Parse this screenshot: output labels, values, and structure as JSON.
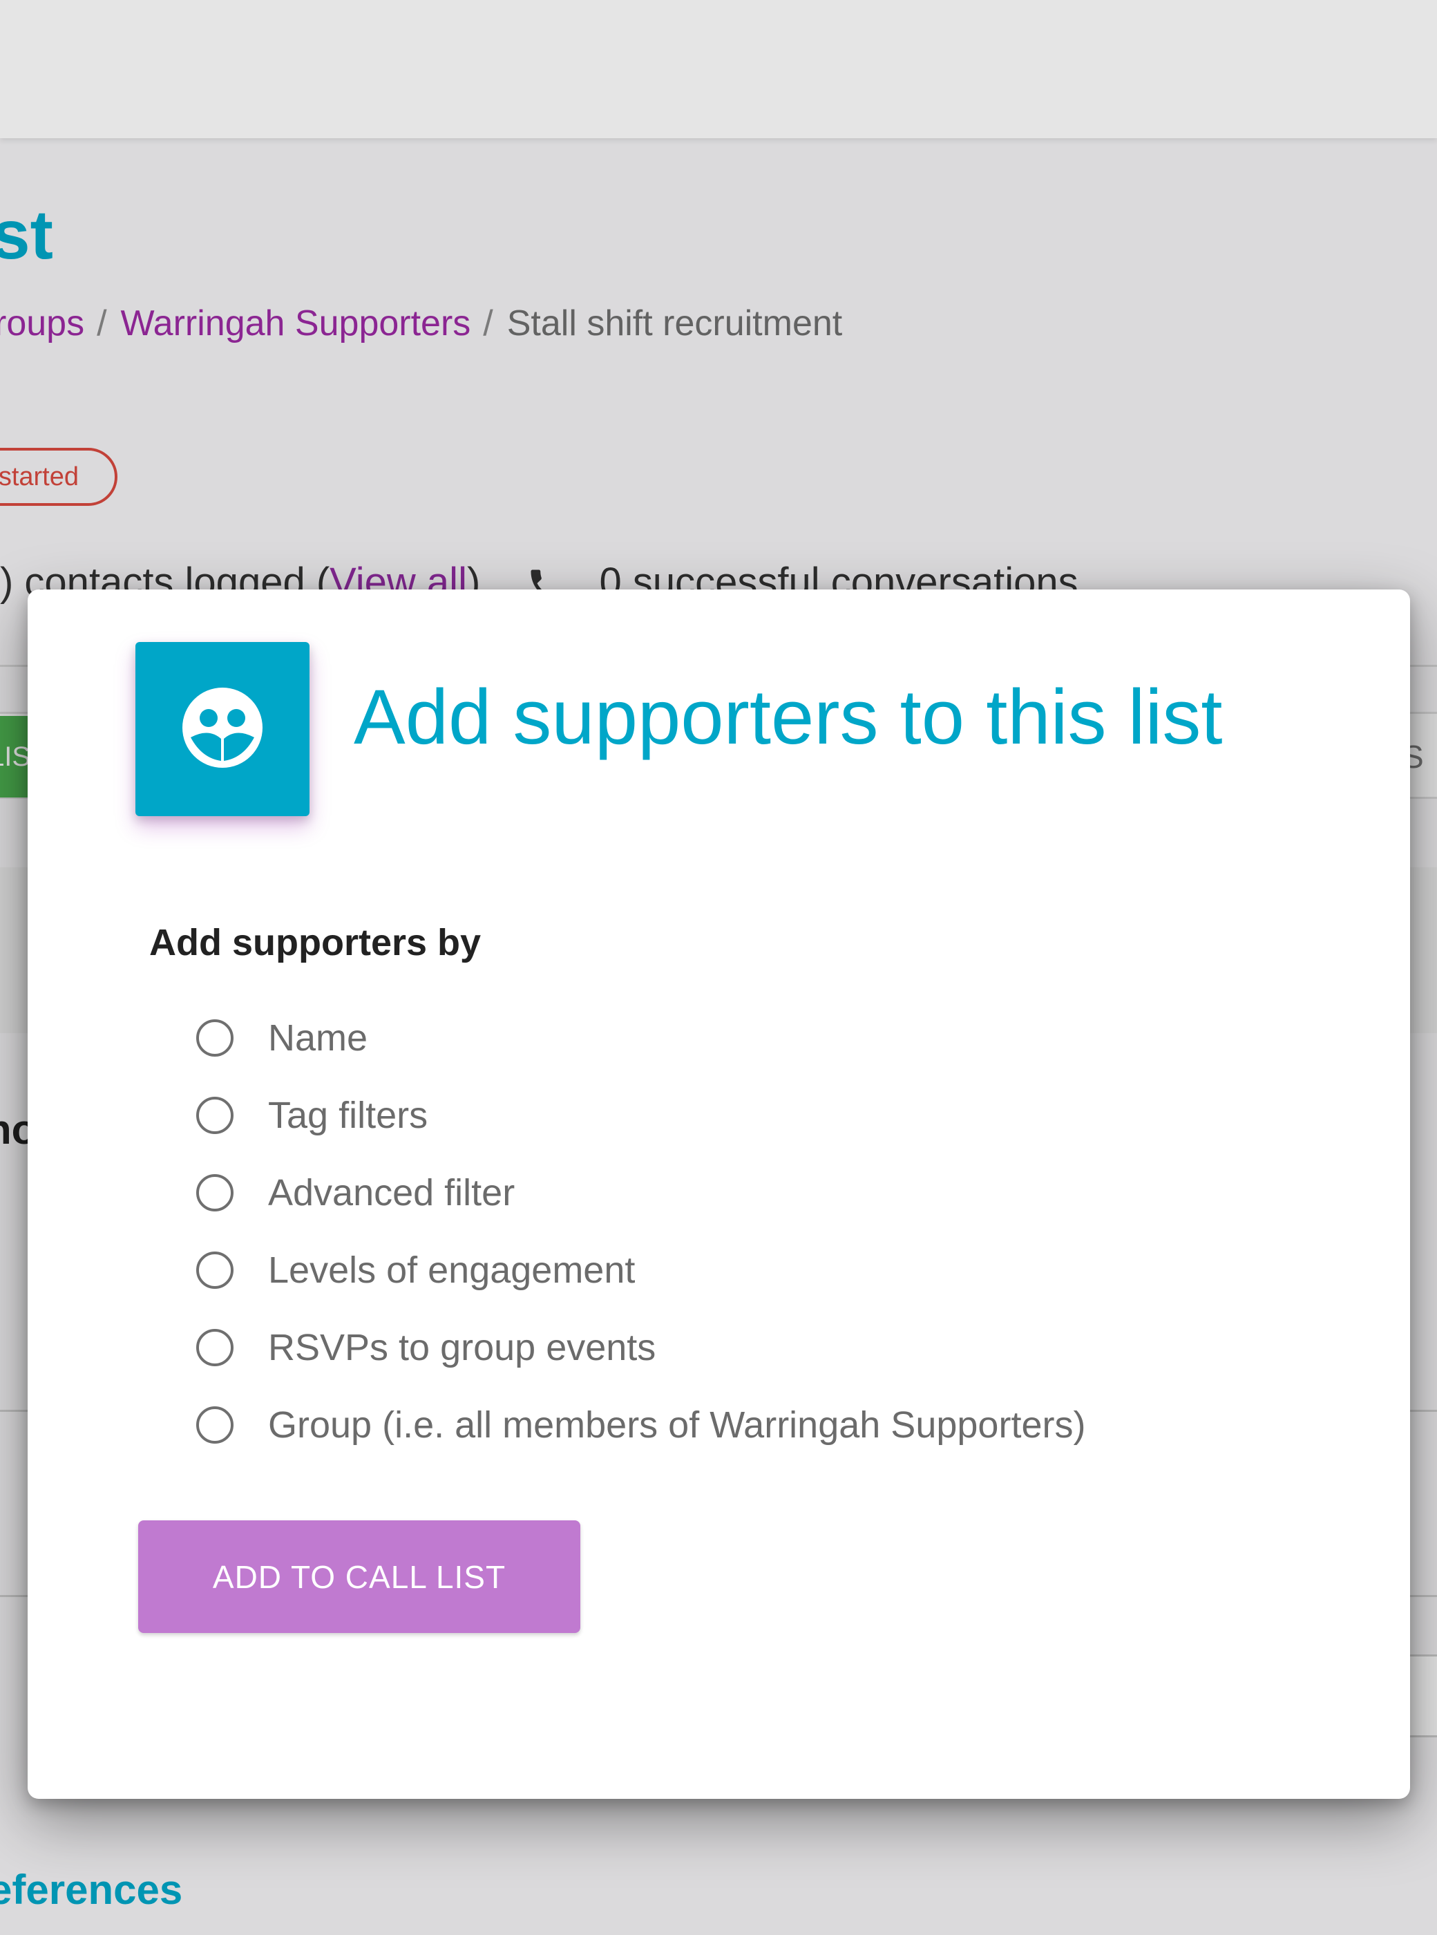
{
  "background": {
    "page_title_fragment": "st",
    "breadcrumb": {
      "item1": "roups",
      "item2": "Warringah Supporters",
      "current": "Stall shift recruitment",
      "separator": "/"
    },
    "status_badge": "started",
    "stats": {
      "contacts_text": ") contacts logged (",
      "view_all": "View all",
      "contacts_close": ")",
      "conversations": "0 successful conversations"
    },
    "tab_left_fragment": "LIS",
    "tab_right_fragment": "S",
    "heading_fragment": "no",
    "footer_heading_fragment": "eferences"
  },
  "modal": {
    "title": "Add supporters to this list",
    "icon": "group-icon",
    "section_label": "Add supporters by",
    "options": [
      {
        "label": "Name",
        "selected": false
      },
      {
        "label": "Tag filters",
        "selected": false
      },
      {
        "label": "Advanced filter",
        "selected": false
      },
      {
        "label": "Levels of engagement",
        "selected": false
      },
      {
        "label": "RSVPs to group events",
        "selected": false
      },
      {
        "label": "Group (i.e. all members of Warringah Supporters)",
        "selected": false
      }
    ],
    "submit_label": "ADD TO CALL LIST"
  },
  "colors": {
    "accent": "#00a6c8",
    "link": "#9b2aa3",
    "status_red": "#d8493f",
    "button": "#c07ad0"
  }
}
